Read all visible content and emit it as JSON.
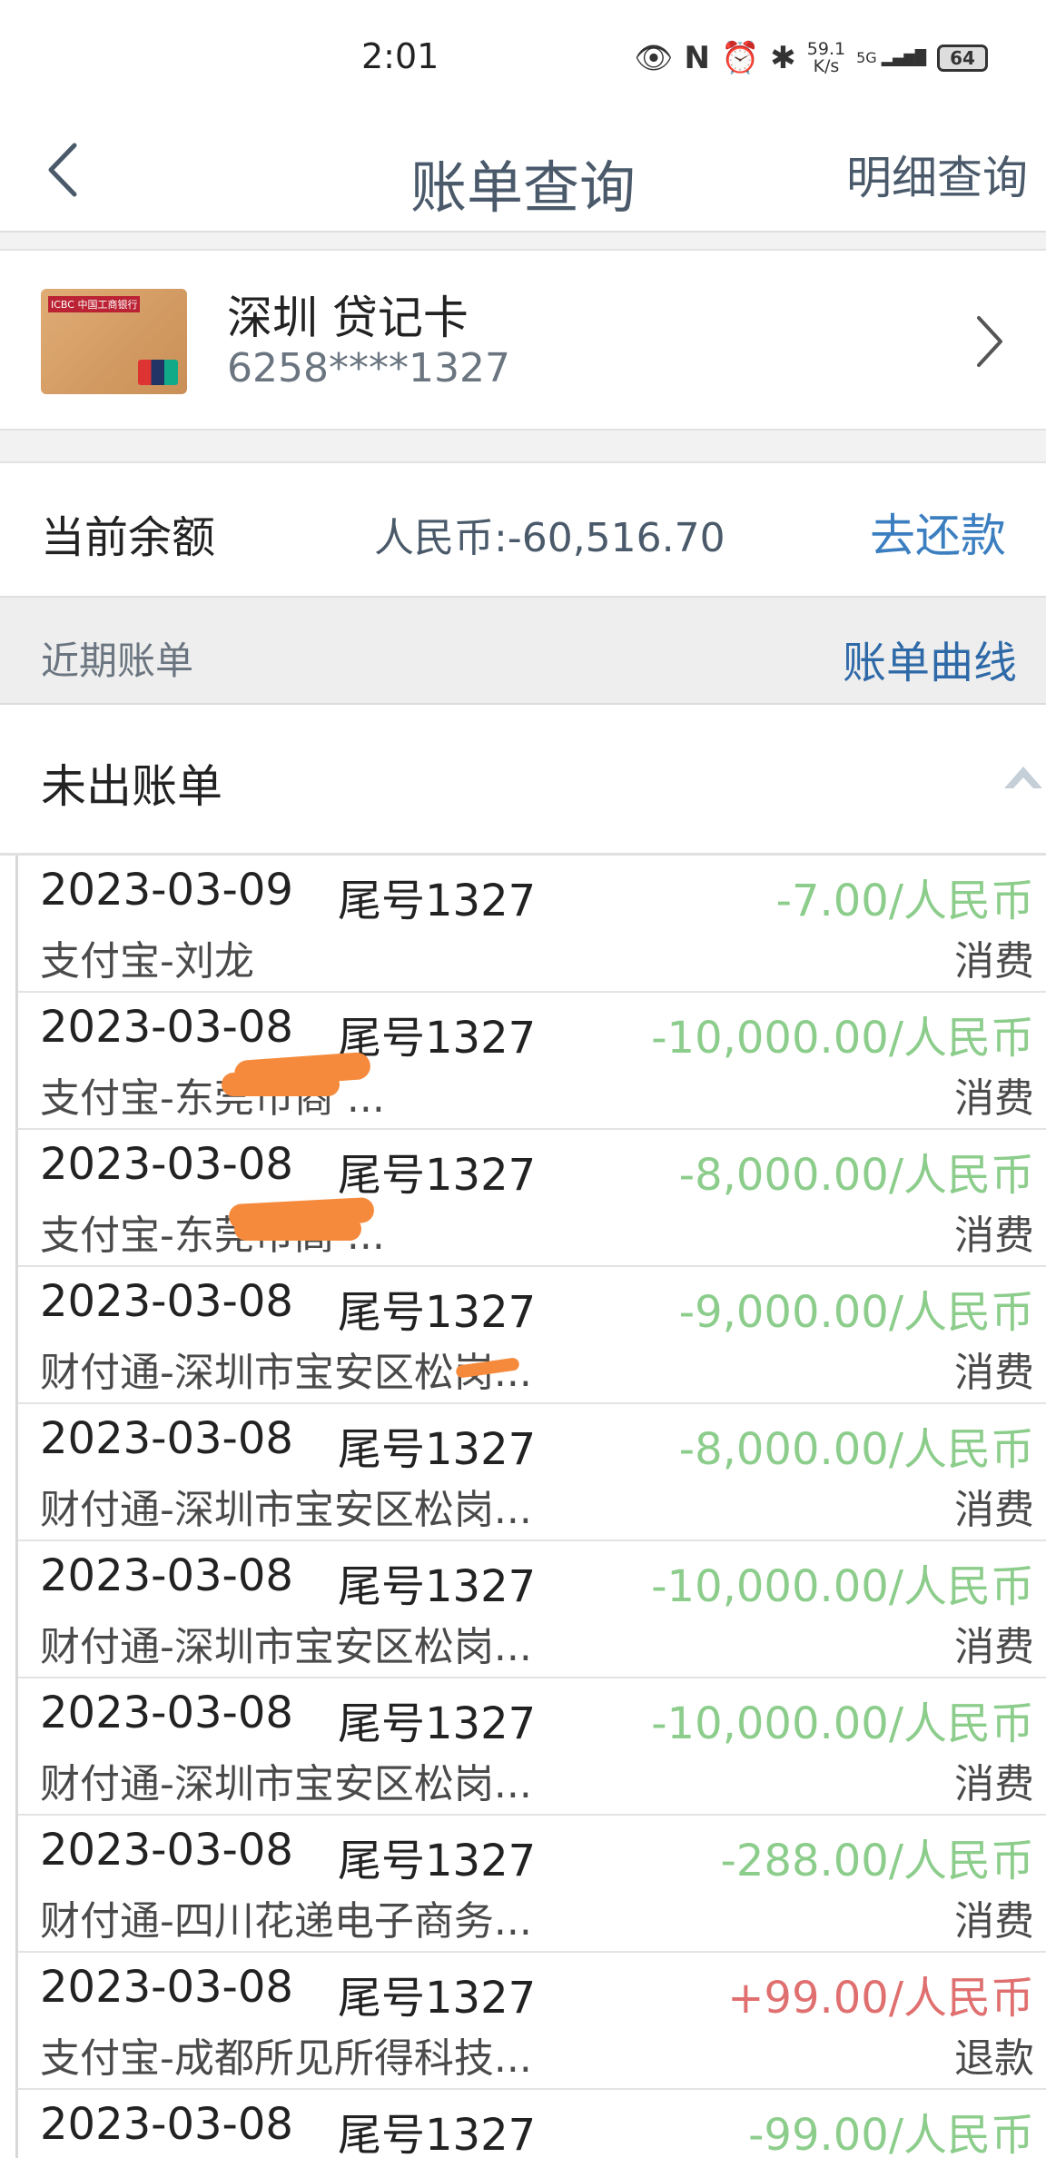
{
  "status_bar": {
    "time": "2:01",
    "net_speed_top": "59.1",
    "net_speed_bottom": "K/s",
    "battery": "64",
    "signal_label": "5G"
  },
  "nav": {
    "title": "账单查询",
    "detail_link": "明细查询"
  },
  "card": {
    "name": "深圳 贷记卡",
    "number": "6258****1327",
    "logo_text": "ICBC 中国工商银行"
  },
  "balance": {
    "label": "当前余额",
    "value": "人民币:-60,516.70",
    "repay_label": "去还款"
  },
  "recent": {
    "label": "近期账单",
    "curve_link": "账单曲线"
  },
  "unbilled": {
    "label": "未出账单"
  },
  "transactions": [
    {
      "date": "2023-03-09",
      "tail": "尾号1327",
      "amount": "-7.00/人民币",
      "merchant": "支付宝-刘龙",
      "type": "消费"
    },
    {
      "date": "2023-03-08",
      "tail": "尾号1327",
      "amount": "-10,000.00/人民币",
      "merchant": "支付宝-东莞市商                 ...",
      "type": "消费"
    },
    {
      "date": "2023-03-08",
      "tail": "尾号1327",
      "amount": "-8,000.00/人民币",
      "merchant": "支付宝-东莞市高                 ...",
      "type": "消费"
    },
    {
      "date": "2023-03-08",
      "tail": "尾号1327",
      "amount": "-9,000.00/人民币",
      "merchant": "财付通-深圳市宝安区松岗...",
      "type": "消费"
    },
    {
      "date": "2023-03-08",
      "tail": "尾号1327",
      "amount": "-8,000.00/人民币",
      "merchant": "财付通-深圳市宝安区松岗...",
      "type": "消费"
    },
    {
      "date": "2023-03-08",
      "tail": "尾号1327",
      "amount": "-10,000.00/人民币",
      "merchant": "财付通-深圳市宝安区松岗...",
      "type": "消费"
    },
    {
      "date": "2023-03-08",
      "tail": "尾号1327",
      "amount": "-10,000.00/人民币",
      "merchant": "财付通-深圳市宝安区松岗...",
      "type": "消费"
    },
    {
      "date": "2023-03-08",
      "tail": "尾号1327",
      "amount": "-288.00/人民币",
      "merchant": "财付通-四川花递电子商务...",
      "type": "消费"
    },
    {
      "date": "2023-03-08",
      "tail": "尾号1327",
      "amount": "+99.00/人民币",
      "merchant": "支付宝-成都所见所得科技...",
      "type": "退款"
    },
    {
      "date": "2023-03-08",
      "tail": "尾号1327",
      "amount": "-99.00/人民币",
      "merchant": "",
      "type": ""
    }
  ],
  "colors": {
    "debit_amount": "#8ccd8c",
    "refund_amount": "#e07070",
    "link_blue": "#3b7fc1",
    "redaction": "#f58a3c"
  }
}
